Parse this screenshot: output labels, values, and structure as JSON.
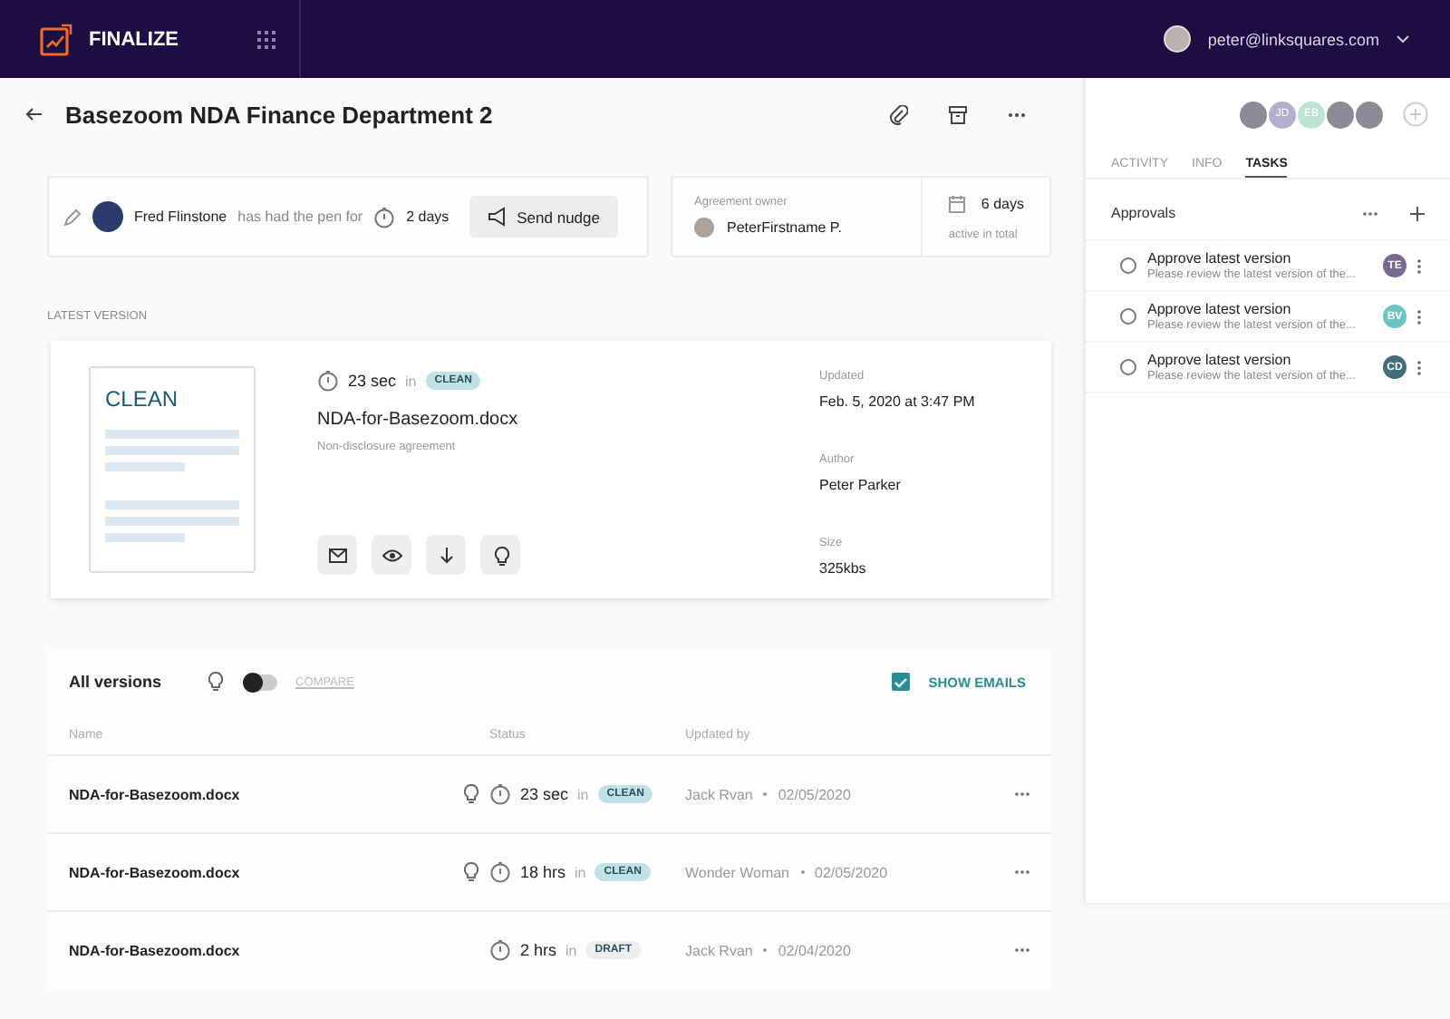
{
  "header": {
    "logo": "FINALIZE",
    "user_email": "peter@linksquares.com"
  },
  "document": {
    "title": "Basezoom NDA Finance Department 2"
  },
  "pen": {
    "holder": "Fred Flinstone",
    "text": "has had the pen for",
    "duration": "2 days",
    "nudge_button": "Send nudge"
  },
  "owner": {
    "label": "Agreement owner",
    "name": "PeterFirstname P.",
    "days": "6 days",
    "days_caption": "active in total"
  },
  "latest_version": {
    "section_label": "LATEST VERSION",
    "thumbnail_label": "CLEAN",
    "duration": "23 sec",
    "in": "in",
    "status": "CLEAN",
    "color": "#bfe1e8",
    "filename": "NDA-for-Basezoom.docx",
    "description": "Non-disclosure agreement",
    "details": [
      {
        "label": "Updated",
        "value": "Feb. 5, 2020 at 3:47 PM"
      },
      {
        "label": "Author",
        "value": "Peter Parker"
      },
      {
        "label": "Size",
        "value": "325kbs"
      }
    ]
  },
  "versions": {
    "title": "All versions",
    "compare": {
      "label": "COMPARE",
      "on": false
    },
    "show_emails": {
      "label": "SHOW EMAILS",
      "checked": true
    },
    "columns": [
      "Name",
      "Status",
      "Updated by"
    ],
    "rows": [
      {
        "name": "NDA-for-Basezoom.docx",
        "has_insight": true,
        "duration": "23 sec",
        "in": "in",
        "status": "CLEAN",
        "color": "#bfe1e8",
        "updated_by": "Jack Rvan",
        "date": "02/05/2020"
      },
      {
        "name": "NDA-for-Basezoom.docx",
        "has_insight": true,
        "duration": "18 hrs",
        "in": "in",
        "status": "CLEAN",
        "color": "#bfe1e8",
        "updated_by": "Wonder Woman",
        "date": "02/05/2020"
      },
      {
        "name": "NDA-for-Basezoom.docx",
        "has_insight": false,
        "duration": "2 hrs",
        "in": "in",
        "status": "DRAFT",
        "color": "#eeeeee",
        "updated_by": "Jack Rvan",
        "date": "02/04/2020"
      }
    ]
  },
  "panel": {
    "avatars": [
      {
        "kind": "photo"
      },
      {
        "kind": "initials",
        "initials": "JD",
        "color": "#b3aecb"
      },
      {
        "kind": "initials",
        "initials": "EB",
        "color": "#bfe3d3"
      },
      {
        "kind": "photo"
      },
      {
        "kind": "photo"
      }
    ],
    "tabs": [
      {
        "label": "ACTIVITY",
        "selected": false
      },
      {
        "label": "INFO",
        "selected": false
      },
      {
        "label": "TASKS",
        "selected": true
      }
    ],
    "section_title": "Approvals",
    "tasks": [
      {
        "title": "Approve latest version",
        "description": "Please review the latest version of the...",
        "assignee": "TE",
        "color": "#75698f",
        "checked": false
      },
      {
        "title": "Approve latest version",
        "description": "Please review the latest version of the...",
        "assignee": "BV",
        "color": "#6cc3c4",
        "checked": false
      },
      {
        "title": "Approve latest version",
        "description": "Please review the latest version of the...",
        "assignee": "CD",
        "color": "#3f6f78",
        "checked": false
      }
    ]
  }
}
